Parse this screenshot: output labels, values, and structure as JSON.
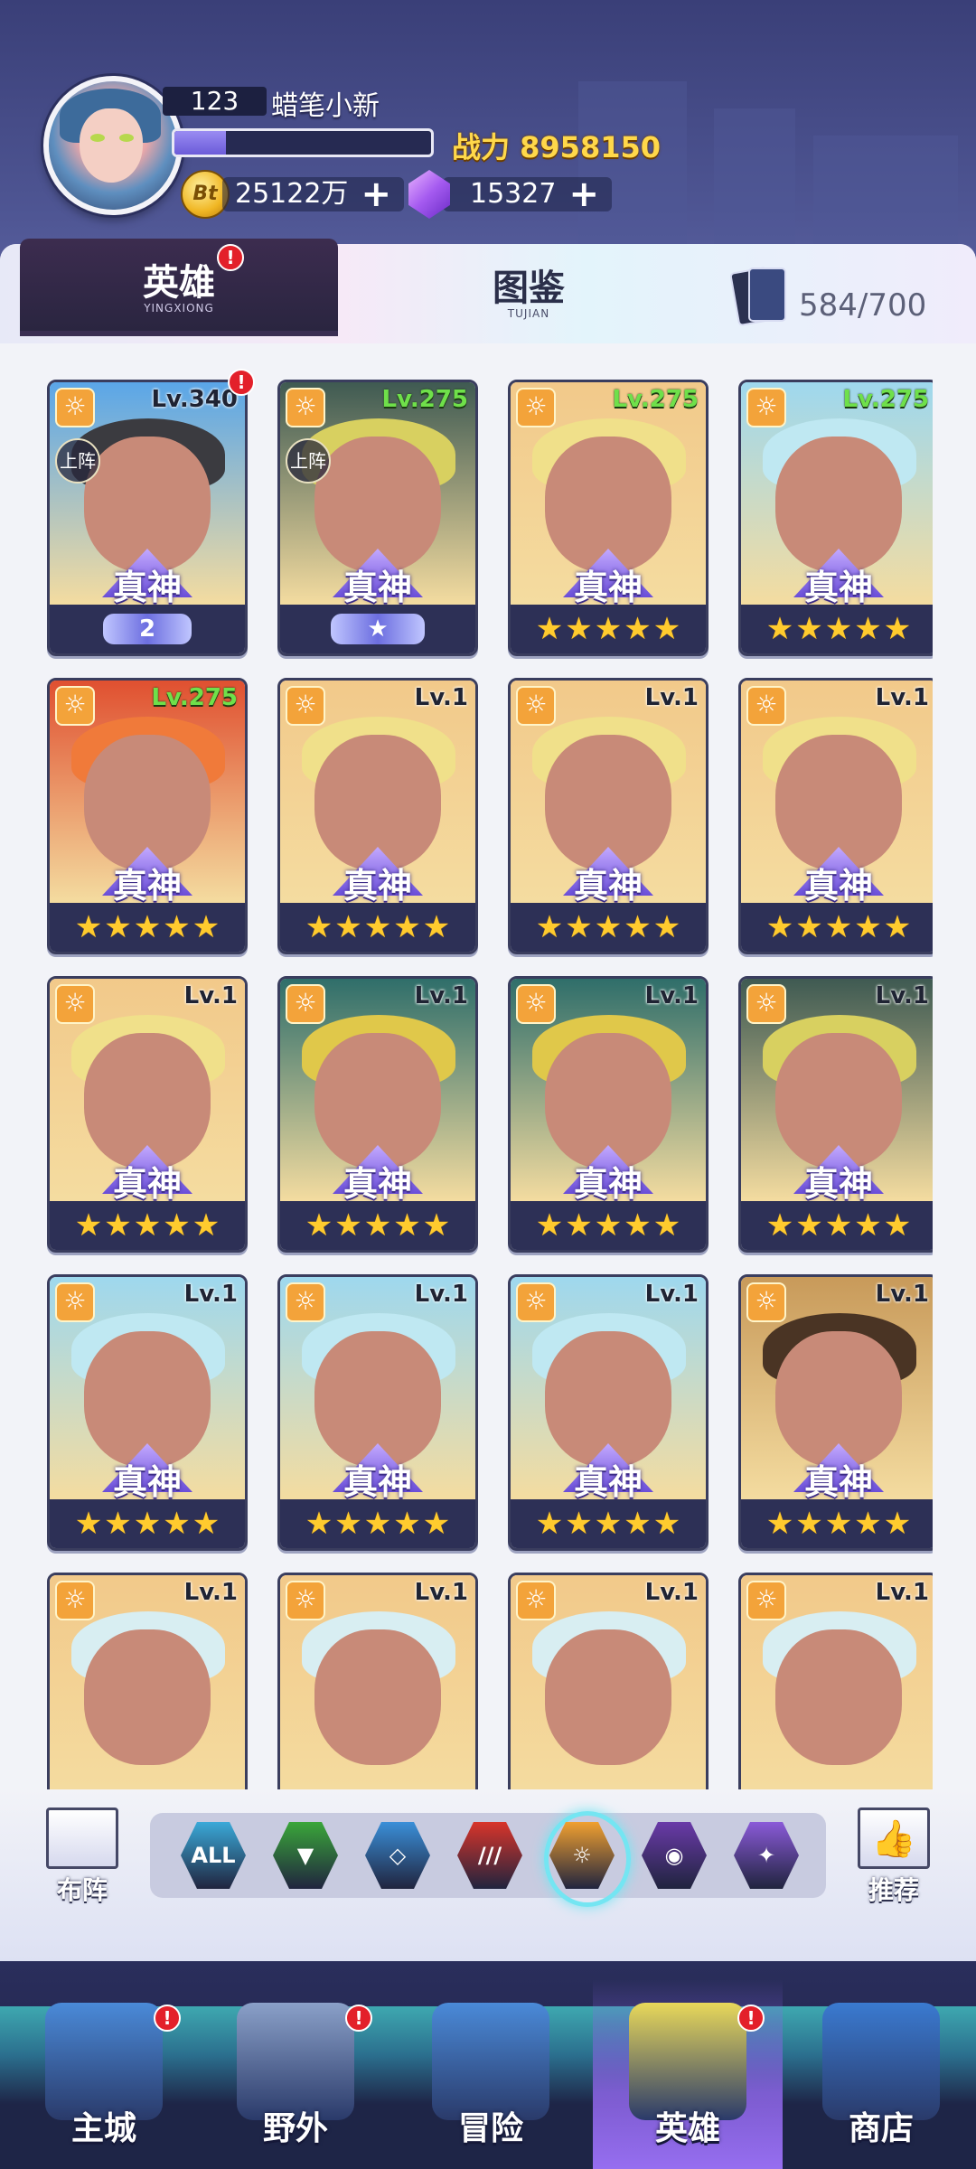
{
  "player": {
    "level": "123",
    "name": "蜡笔小新",
    "exp_progress": 0.2,
    "power_label": "战力 8958150",
    "coins": "25122万",
    "coin_symbol": "Bt",
    "gems": "15327",
    "plus": "+"
  },
  "tabs": {
    "hero": {
      "title": "英雄",
      "sub": "YINGXIONG",
      "badge": "!"
    },
    "atlas": {
      "title": "图鉴",
      "sub": "TUJIAN"
    },
    "count": "584/700"
  },
  "hero_strings": {
    "rank": "真神",
    "onteam": "上阵",
    "star": "★",
    "element_glyph": "☼"
  },
  "heroes": [
    {
      "level": "Lv.340",
      "green": false,
      "onteam": true,
      "badge": "!",
      "bottom": "wing",
      "wing_text": "2",
      "art": "#5aa6e8",
      "hair": "#3b3b40"
    },
    {
      "level": "Lv.275",
      "green": true,
      "onteam": true,
      "bottom": "wing",
      "wing_text": "",
      "art": "#3f5a52",
      "hair": "#d8d060"
    },
    {
      "level": "Lv.275",
      "green": true,
      "bottom": "stars",
      "art": "#f2c98a",
      "hair": "#f0e08a"
    },
    {
      "level": "Lv.275",
      "green": true,
      "bottom": "stars",
      "art": "#9ed8ee",
      "hair": "#bfe8f2"
    },
    {
      "level": "Lv.275",
      "green": true,
      "bottom": "stars",
      "art": "#e05030",
      "hair": "#f07a3a"
    },
    {
      "level": "Lv.1",
      "green": false,
      "bottom": "stars",
      "art": "#f2c98a",
      "hair": "#f0e08a"
    },
    {
      "level": "Lv.1",
      "green": false,
      "bottom": "stars",
      "art": "#f2c98a",
      "hair": "#f0e08a"
    },
    {
      "level": "Lv.1",
      "green": false,
      "bottom": "stars",
      "art": "#f2c98a",
      "hair": "#f0e08a"
    },
    {
      "level": "Lv.1",
      "green": false,
      "bottom": "stars",
      "art": "#f2c98a",
      "hair": "#f0e08a"
    },
    {
      "level": "Lv.1",
      "green": false,
      "bottom": "stars",
      "art": "#2f6e6a",
      "hair": "#e0c84a"
    },
    {
      "level": "Lv.1",
      "green": false,
      "bottom": "stars",
      "art": "#2f6e6a",
      "hair": "#e0c84a"
    },
    {
      "level": "Lv.1",
      "green": false,
      "bottom": "stars",
      "art": "#3f5a52",
      "hair": "#d8d060"
    },
    {
      "level": "Lv.1",
      "green": false,
      "bottom": "stars",
      "art": "#9ed8ee",
      "hair": "#bfe8f2"
    },
    {
      "level": "Lv.1",
      "green": false,
      "bottom": "stars",
      "art": "#9ed8ee",
      "hair": "#bfe8f2"
    },
    {
      "level": "Lv.1",
      "green": false,
      "bottom": "stars",
      "art": "#9ed8ee",
      "hair": "#bfe8f2"
    },
    {
      "level": "Lv.1",
      "green": false,
      "bottom": "stars",
      "art": "#c89a5a",
      "hair": "#4a3424"
    },
    {
      "level": "Lv.1",
      "green": false,
      "bottom": "none",
      "art": "#f2c98a",
      "hair": "#d8eef2"
    },
    {
      "level": "Lv.1",
      "green": false,
      "bottom": "none",
      "art": "#f2c98a",
      "hair": "#d8eef2"
    },
    {
      "level": "Lv.1",
      "green": false,
      "bottom": "none",
      "art": "#f2c98a",
      "hair": "#d8eef2"
    },
    {
      "level": "Lv.1",
      "green": false,
      "bottom": "none",
      "art": "#f2c98a",
      "hair": "#d8eef2"
    }
  ],
  "filters": {
    "formation_label": "布阵",
    "recommend_label": "推荐",
    "items": [
      {
        "name": "all",
        "label": "ALL",
        "color": "#3aa9d8"
      },
      {
        "name": "nature",
        "label": "▼",
        "color": "#3aa63a"
      },
      {
        "name": "water",
        "label": "◇",
        "color": "#3a8fd8"
      },
      {
        "name": "fire",
        "label": "///",
        "color": "#d8342a"
      },
      {
        "name": "light",
        "label": "☼",
        "color": "#f0a030",
        "selected": true
      },
      {
        "name": "dark",
        "label": "◉",
        "color": "#6a3aa8"
      },
      {
        "name": "arcane",
        "label": "✦",
        "color": "#8a5ad8"
      }
    ]
  },
  "nav": [
    {
      "name": "main-city",
      "label": "主城",
      "badge": "!",
      "color": "#4a8ad8"
    },
    {
      "name": "wild",
      "label": "野外",
      "badge": "!",
      "color": "#8aa0c8"
    },
    {
      "name": "adventure",
      "label": "冒险",
      "color": "#4a8ad8"
    },
    {
      "name": "heroes",
      "label": "英雄",
      "badge": "!",
      "active": true,
      "color": "#e8d85a"
    },
    {
      "name": "shop",
      "label": "商店",
      "color": "#3a7ad0"
    }
  ],
  "colors": {
    "accent": "#74e5f2",
    "power": "#ffd84a",
    "badge": "#e3202a",
    "star": "#ffcb2e"
  }
}
